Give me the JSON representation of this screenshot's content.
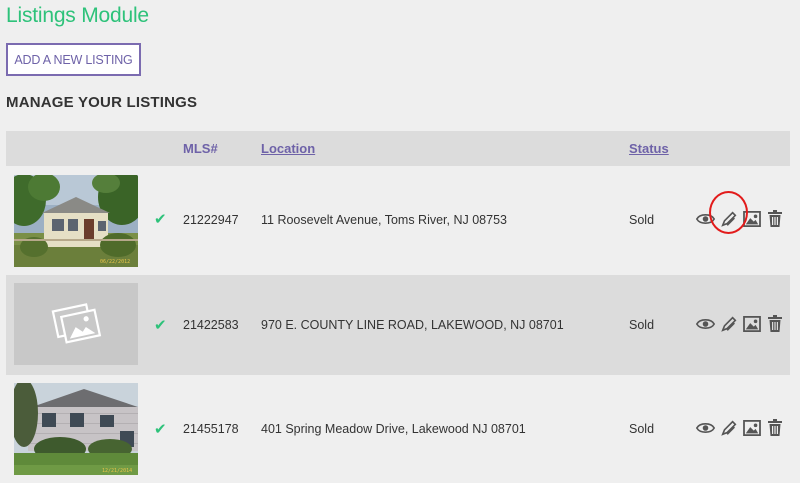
{
  "page_title": "Listings Module",
  "add_button_label": "ADD A NEW LISTING",
  "section_title": "MANAGE YOUR LISTINGS",
  "table": {
    "headers": {
      "mls": "MLS#",
      "location": "Location",
      "status": "Status"
    },
    "rows": [
      {
        "mls": "21222947",
        "location": "11 Roosevelt Avenue, Toms River, NJ 08753",
        "status": "Sold",
        "photo_date": "06/22/2012"
      },
      {
        "mls": "21422583",
        "location": "970 E. COUNTY LINE ROAD, LAKEWOOD, NJ 08701",
        "status": "Sold"
      },
      {
        "mls": "21455178",
        "location": "401 Spring Meadow Drive, Lakewood NJ 08701",
        "status": "Sold",
        "photo_date": "12/21/2014"
      }
    ]
  },
  "icons": {
    "check": "check-icon",
    "view": "eye-icon",
    "edit": "pencil-icon",
    "photos": "image-icon",
    "delete": "trash-icon"
  },
  "colors": {
    "accent_green": "#2ec27a",
    "link_purple": "#6e62a8",
    "highlight_red": "#e21b1b",
    "header_bg": "#dcdcdc",
    "page_bg": "#efefef"
  }
}
